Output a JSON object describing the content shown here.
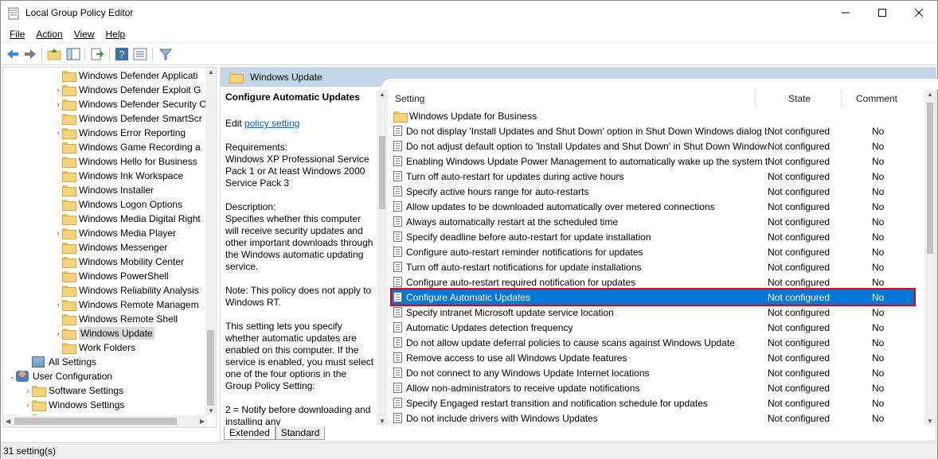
{
  "window": {
    "title": "Local Group Policy Editor"
  },
  "menu": [
    "File",
    "Action",
    "View",
    "Help"
  ],
  "tree": [
    {
      "label": "Windows Defender Applicati",
      "level": 2,
      "arrow": ""
    },
    {
      "label": "Windows Defender Exploit G",
      "level": 2,
      "arrow": "›"
    },
    {
      "label": "Windows Defender Security C",
      "level": 2,
      "arrow": "›"
    },
    {
      "label": "Windows Defender SmartScr",
      "level": 2,
      "arrow": ""
    },
    {
      "label": "Windows Error Reporting",
      "level": 2,
      "arrow": "›"
    },
    {
      "label": "Windows Game Recording a",
      "level": 2,
      "arrow": ""
    },
    {
      "label": "Windows Hello for Business",
      "level": 2,
      "arrow": ""
    },
    {
      "label": "Windows Ink Workspace",
      "level": 2,
      "arrow": ""
    },
    {
      "label": "Windows Installer",
      "level": 2,
      "arrow": ""
    },
    {
      "label": "Windows Logon Options",
      "level": 2,
      "arrow": ""
    },
    {
      "label": "Windows Media Digital Right",
      "level": 2,
      "arrow": ""
    },
    {
      "label": "Windows Media Player",
      "level": 2,
      "arrow": "›"
    },
    {
      "label": "Windows Messenger",
      "level": 2,
      "arrow": ""
    },
    {
      "label": "Windows Mobility Center",
      "level": 2,
      "arrow": ""
    },
    {
      "label": "Windows PowerShell",
      "level": 2,
      "arrow": ""
    },
    {
      "label": "Windows Reliability Analysis",
      "level": 2,
      "arrow": ""
    },
    {
      "label": "Windows Remote Managem",
      "level": 2,
      "arrow": "›"
    },
    {
      "label": "Windows Remote Shell",
      "level": 2,
      "arrow": ""
    },
    {
      "label": "Windows Update",
      "level": 2,
      "arrow": "›",
      "selected": true
    },
    {
      "label": "Work Folders",
      "level": 2,
      "arrow": ""
    },
    {
      "label": "All Settings",
      "level": 1,
      "arrow": "",
      "icon": "settings"
    },
    {
      "label": "User Configuration",
      "level": 0,
      "arrow": "⌄",
      "icon": "user"
    },
    {
      "label": "Software Settings",
      "level": 1,
      "arrow": "›"
    },
    {
      "label": "Windows Settings",
      "level": 1,
      "arrow": "›"
    },
    {
      "label": "Administrative Templates",
      "level": 1,
      "arrow": "›"
    }
  ],
  "pane": {
    "header": "Windows Update",
    "desc_title": "Configure Automatic Updates",
    "edit_prefix": "Edit ",
    "edit_link": "policy setting",
    "requirements": "Requirements:\nWindows XP Professional Service Pack 1 or At least Windows 2000 Service Pack 3",
    "description": "Description:\nSpecifies whether this computer will receive security updates and other important downloads through the Windows automatic updating service.",
    "note": "Note: This policy does not apply to Windows RT.",
    "body": "This setting lets you specify whether automatic updates are enabled on this computer. If the service is enabled, you must select one of the four options in the Group Policy Setting:",
    "option": "        2 = Notify before downloading and installing any"
  },
  "columns": {
    "setting": "Setting",
    "state": "State",
    "comment": "Comment"
  },
  "rows": [
    {
      "name": "Windows Update for Business",
      "state": "",
      "comment": "",
      "folder": true
    },
    {
      "name": "Do not display 'Install Updates and Shut Down' option in Shut Down Windows dialog box",
      "state": "Not configured",
      "comment": "No"
    },
    {
      "name": "Do not adjust default option to 'Install Updates and Shut Down' in Shut Down Windows dialog box",
      "state": "Not configured",
      "comment": "No"
    },
    {
      "name": "Enabling Windows Update Power Management to automatically wake up the system to install updates",
      "state": "Not configured",
      "comment": "No"
    },
    {
      "name": "Turn off auto-restart for updates during active hours",
      "state": "Not configured",
      "comment": "No"
    },
    {
      "name": "Specify active hours range for auto-restarts",
      "state": "Not configured",
      "comment": "No"
    },
    {
      "name": "Allow updates to be downloaded automatically over metered connections",
      "state": "Not configured",
      "comment": "No"
    },
    {
      "name": "Always automatically restart at the scheduled time",
      "state": "Not configured",
      "comment": "No"
    },
    {
      "name": "Specify deadline before auto-restart for update installation",
      "state": "Not configured",
      "comment": "No"
    },
    {
      "name": "Configure auto-restart reminder notifications for updates",
      "state": "Not configured",
      "comment": "No"
    },
    {
      "name": "Turn off auto-restart notifications for update installations",
      "state": "Not configured",
      "comment": "No"
    },
    {
      "name": "Configure auto-restart required notification for updates",
      "state": "Not configured",
      "comment": "No"
    },
    {
      "name": "Configure Automatic Updates",
      "state": "Not configured",
      "comment": "No",
      "selected": true
    },
    {
      "name": "Specify intranet Microsoft update service location",
      "state": "Not configured",
      "comment": "No"
    },
    {
      "name": "Automatic Updates detection frequency",
      "state": "Not configured",
      "comment": "No"
    },
    {
      "name": "Do not allow update deferral policies to cause scans against Windows Update",
      "state": "Not configured",
      "comment": "No"
    },
    {
      "name": "Remove access to use all Windows Update features",
      "state": "Not configured",
      "comment": "No"
    },
    {
      "name": "Do not connect to any Windows Update Internet locations",
      "state": "Not configured",
      "comment": "No"
    },
    {
      "name": "Allow non-administrators to receive update notifications",
      "state": "Not configured",
      "comment": "No"
    },
    {
      "name": "Specify Engaged restart transition and notification schedule for updates",
      "state": "Not configured",
      "comment": "No"
    },
    {
      "name": "Do not include drivers with Windows Updates",
      "state": "Not configured",
      "comment": "No"
    }
  ],
  "tabs": [
    "Extended",
    "Standard"
  ],
  "status": "31 setting(s)",
  "colors": {
    "selection": "#0078d7",
    "highlight_border": "#e0000e",
    "header_band": "#c3d5e8"
  }
}
